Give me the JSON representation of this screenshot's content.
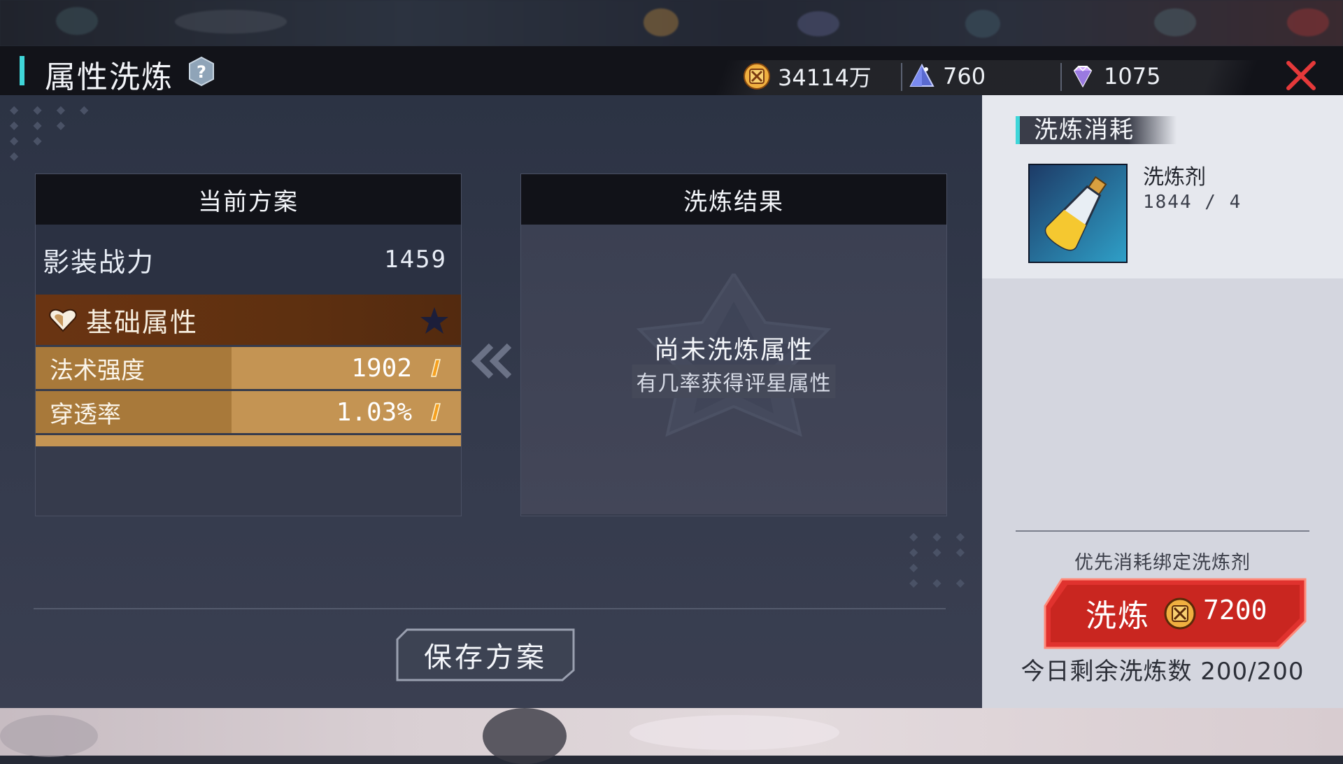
{
  "header": {
    "title": "属性洗炼",
    "resources": [
      {
        "icon": "gold-coin-icon",
        "value": "34114万"
      },
      {
        "icon": "crystal-pyramid-icon",
        "value": "760"
      },
      {
        "icon": "diamond-icon",
        "value": "1075"
      }
    ]
  },
  "current_plan": {
    "title": "当前方案",
    "power_label": "影装战力",
    "power_value": "1459",
    "base_attr_label": "基础属性",
    "attributes": [
      {
        "name": "法术强度",
        "value": "1902"
      },
      {
        "name": "穿透率",
        "value": "1.03%"
      }
    ]
  },
  "result": {
    "title": "洗炼结果",
    "empty_text": "尚未洗炼属性",
    "hint": "有几率获得评星属性"
  },
  "save_button": "保存方案",
  "cost_panel": {
    "title": "洗炼消耗",
    "item_name": "洗炼剂",
    "item_count": "1844 / 4",
    "note": "优先消耗绑定洗炼剂",
    "refine_label": "洗炼",
    "refine_cost": "7200",
    "remaining": "今日剩余洗炼数 200/200"
  },
  "colors": {
    "accent": "#3fd6d9",
    "header_bg": "#121319",
    "attr_brown": "#6a3412",
    "attr_gold": "#c49453",
    "refine_red": "#e0322e",
    "close_red": "#e5393a"
  }
}
